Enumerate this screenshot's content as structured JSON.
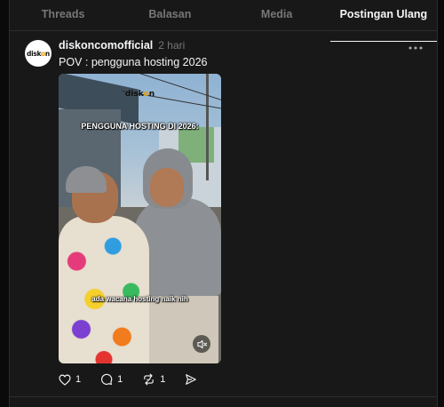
{
  "tabs": [
    {
      "label": "Threads",
      "active": false
    },
    {
      "label": "Balasan",
      "active": false
    },
    {
      "label": "Media",
      "active": false
    },
    {
      "label": "Postingan Ulang",
      "active": true
    }
  ],
  "post": {
    "avatar_text_pre": "disk",
    "avatar_text_o": "o",
    "avatar_text_post": "n",
    "username": "diskoncomofficial",
    "time": "2 hari",
    "caption": "POV : pengguna hosting 2026",
    "video": {
      "logo_pre": "disk",
      "logo_o": "o",
      "logo_post": "n",
      "title_overlay": "PENGGUNA HOSTING DI 2026:",
      "subtitle_overlay": "ada wacana hosting naik nih",
      "mute_icon": "speaker-muted-icon"
    },
    "actions": {
      "likes": "1",
      "replies": "1",
      "reposts": "1",
      "like_icon": "heart-icon",
      "reply_icon": "comment-icon",
      "repost_icon": "repost-icon",
      "share_icon": "send-icon"
    }
  },
  "colors": {
    "background": "#0a0a0a",
    "panel": "#181818",
    "text": "#f3f5f7",
    "muted": "#777777",
    "logo_accent": "#e6a100"
  }
}
